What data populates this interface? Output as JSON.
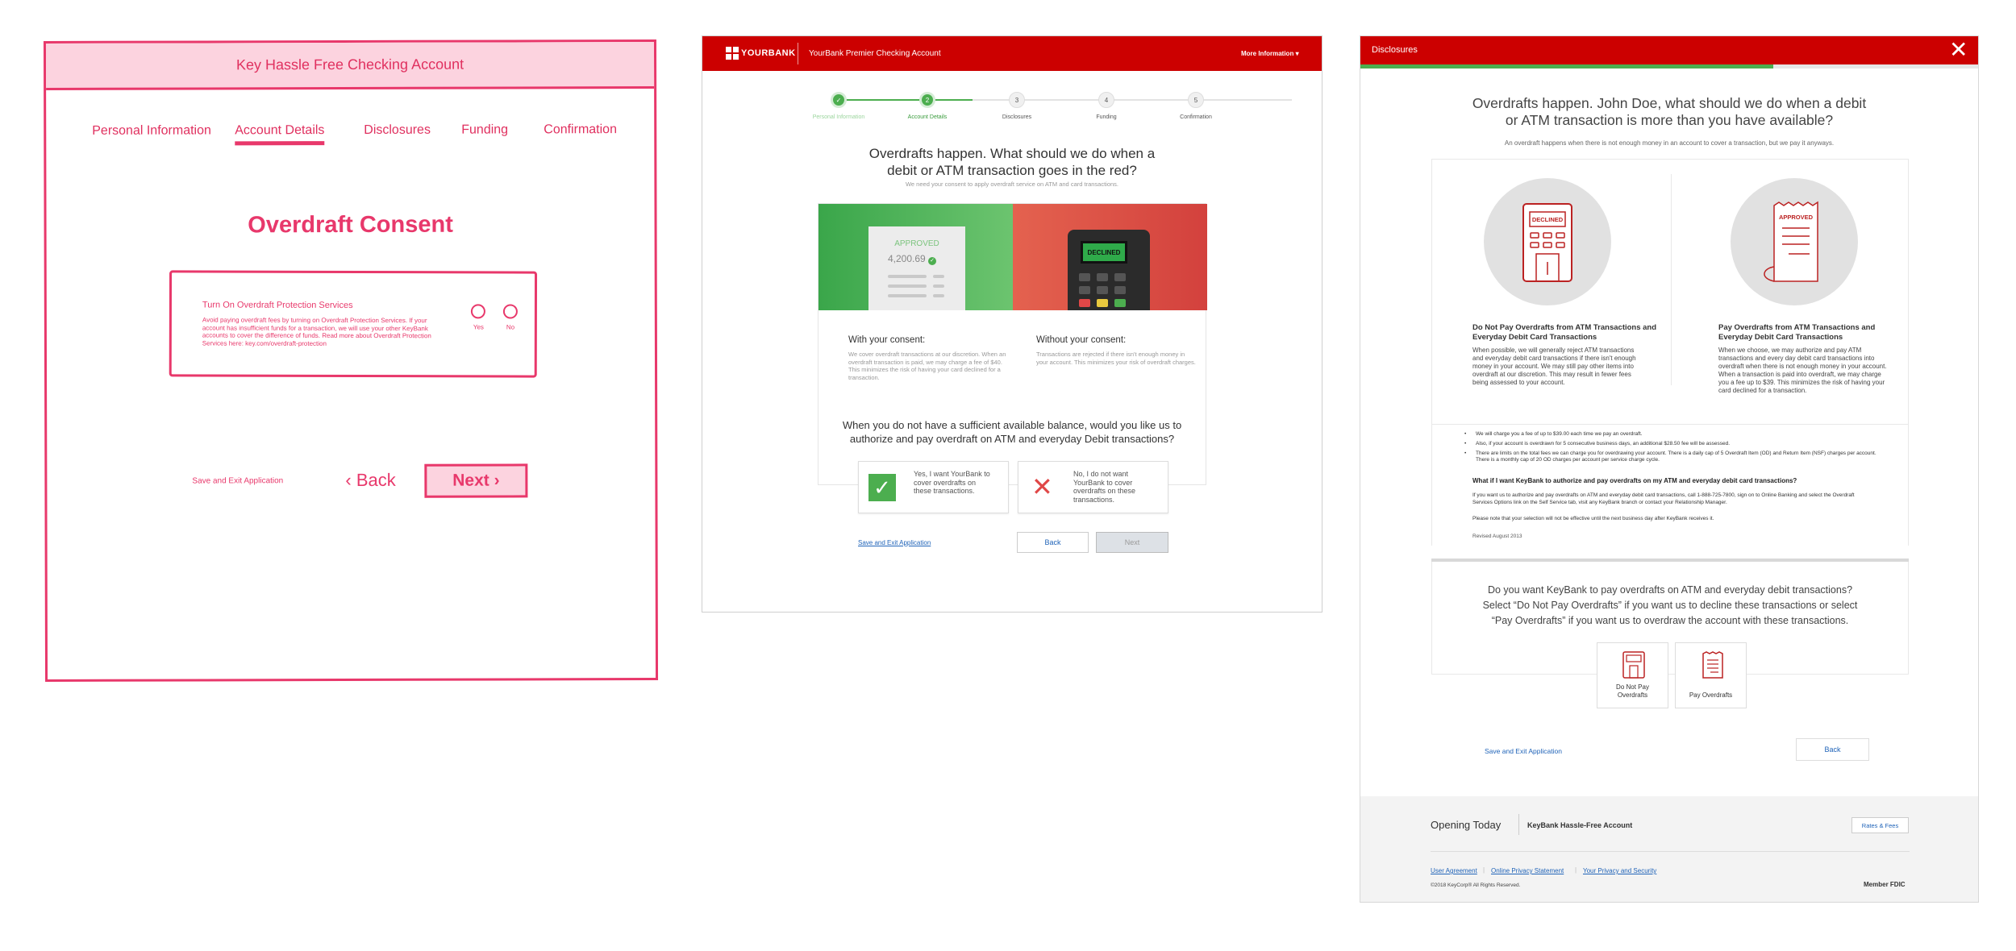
{
  "wireframe": {
    "title": "Key Hassle Free Checking Account",
    "tabs": [
      {
        "label": "Personal Information"
      },
      {
        "label": "Account Details"
      },
      {
        "label": "Disclosures"
      },
      {
        "label": "Funding"
      },
      {
        "label": "Confirmation"
      }
    ],
    "heading": "Overdraft Consent",
    "box_title": "Turn On Overdraft Protection Services",
    "box_text": "Avoid paying overdraft fees by turning on Overdraft Protection Services. If your account has insufficient funds for a transaction, we will use your other KeyBank accounts to cover the difference of funds. Read more about Overdraft Protection Services here: key.com/overdraft-protection",
    "yes_label": "Yes",
    "no_label": "No",
    "save_label": "Save and Exit Application",
    "back_label": "Back",
    "next_label": "Next"
  },
  "mockup": {
    "brand": "YOURBANK",
    "account": "YourBank Premier Checking Account",
    "more_info": "More Information",
    "steps": [
      {
        "num": "✓",
        "label": "Personal Information"
      },
      {
        "num": "2",
        "label": "Account Details"
      },
      {
        "num": "3",
        "label": "Disclosures"
      },
      {
        "num": "4",
        "label": "Funding"
      },
      {
        "num": "5",
        "label": "Confirmation"
      }
    ],
    "question": "Overdrafts happen. What should we do when a debit or ATM transaction goes in the red?",
    "question_sub": "We need your consent to apply overdraft service on ATM and card transactions.",
    "approved": "APPROVED",
    "amount": "4,200.69",
    "declined": "DECLINED",
    "with_title": "With your consent:",
    "with_text": "We cover overdraft transactions at our discretion. When an overdraft transaction is paid, we may charge a fee of $40. This minimizes the risk of having your card declined for a transaction.",
    "without_title": "Without your consent:",
    "without_text": "Transactions are rejected if there isn't enough money in your account. This minimizes your risk of overdraft charges.",
    "question2": "When you do not have a sufficient available balance, would you like us to authorize and pay overdraft on ATM and everyday Debit transactions?",
    "yes_option": "Yes, I want YourBank to cover overdrafts on these transactions.",
    "no_option": "No, I do not want YourBank to cover overdrafts on these transactions.",
    "save_label": "Save and Exit Application",
    "back_label": "Back",
    "next_label": "Next"
  },
  "modal": {
    "title": "Disclosures",
    "heading": "Overdrafts happen. John Doe, what should we do when a debit or ATM transaction is more than you have available?",
    "subheading": "An overdraft happens when there is not enough money in an account to cover a transaction, but we pay it anyways.",
    "declined_badge": "DECLINED",
    "approved_badge": "APPROVED",
    "left_title": "Do Not Pay Overdrafts from ATM Transactions and Everyday Debit Card Transactions",
    "left_text": "When possible, we will generally reject ATM transactions and everyday debit card transactions if there isn't enough money in your account. We may still pay other items into overdraft at our discretion. This may result in fewer fees being assessed to your account.",
    "right_title": "Pay Overdrafts from ATM Transactions and Everyday Debit Card Transactions",
    "right_text": "When we choose, we may authorize and pay ATM transactions and every day debit card transactions into overdraft when there is not enough money in your account. When a transaction is paid into overdraft, we may charge you a fee up to $39. This minimizes the risk of having your card declined for a transaction.",
    "bullet1": "We will charge you a fee of up to $39.00 each time we pay an overdraft.",
    "bullet2": "Also, if your account is overdrawn for 5 consecutive business days, an additional $28.50 fee will be assessed.",
    "bullet3": "There are limits on the total fees we can charge you for overdrawing your account. There is a daily cap of 5 Overdraft Item (OD) and Return Item (NSF) charges per account. There is a monthly cap of 20 OD charges per account per service charge cycle.",
    "fine_heading": "What if I want KeyBank to authorize and pay overdrafts on my ATM and everyday debit card transactions?",
    "fine_text": "If you want us to authorize and pay overdrafts on ATM and everyday debit card transactions, call 1-888-725-7800, sign on to Online Banking and select the Overdraft Services Options link on the Self Service tab, visit any KeyBank branch or contact your Relationship Manager.",
    "fine_note": "Please note that your selection will not be effective until the next business day after KeyBank receives it.",
    "revised": "Revised August 2013",
    "ask": "Do you want KeyBank to pay overdrafts on ATM and everyday debit transactions? Select “Do Not Pay Overdrafts” if you want us to decline these transactions or select “Pay Overdrafts” if you want us to overdraw the account with these transactions.",
    "opt_no": "Do Not Pay Overdrafts",
    "opt_yes": "Pay Overdrafts",
    "save_label": "Save and Exit Application",
    "back_label": "Back",
    "footer": {
      "opening": "Opening Today",
      "product": "KeyBank Hassle-Free Account",
      "rates": "Rates & Fees",
      "links": [
        "User Agreement",
        "Online Privacy Statement",
        "Your Privacy and Security"
      ],
      "copyright": "©2018 KeyCorp® All Rights Reserved.",
      "member": "Member FDIC"
    }
  },
  "colors": {
    "wireframe_pink": "#e8386b",
    "brand_red": "#cc0000",
    "success_green": "#4cae4f",
    "link_blue": "#1f63b8"
  }
}
